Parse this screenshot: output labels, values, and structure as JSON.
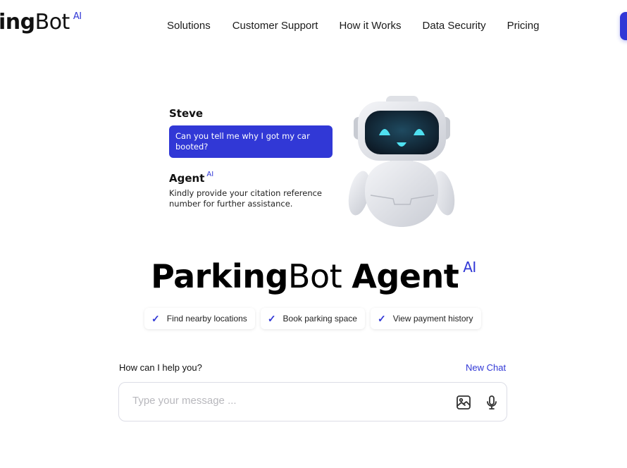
{
  "header": {
    "logo_bold": "ing",
    "logo_light": "Bot",
    "logo_sup": "AI",
    "nav": [
      "Solutions",
      "Customer Support",
      "How it Works",
      "Data Security",
      "Pricing"
    ],
    "accent_color": "#3138d6"
  },
  "chat_preview": {
    "user_name": "Steve",
    "user_message": "Can you tell me why I got my car booted?",
    "agent_name": "Agent",
    "agent_sup": "AI",
    "agent_message": "Kindly provide your citation reference number for further assistance."
  },
  "hero": {
    "title_bold": "Parking",
    "title_light": "Bot",
    "title_bold2": "Agent",
    "title_sup": "AI"
  },
  "features": [
    {
      "icon": "check-icon",
      "label": "Find nearby locations"
    },
    {
      "icon": "check-icon",
      "label": "Book parking space"
    },
    {
      "icon": "check-icon",
      "label": "View payment history"
    }
  ],
  "composer": {
    "label": "How can I help you?",
    "new_chat": "New Chat",
    "placeholder": "Type your message ...",
    "value": "",
    "image_icon": "image-icon",
    "mic_icon": "microphone-icon"
  }
}
